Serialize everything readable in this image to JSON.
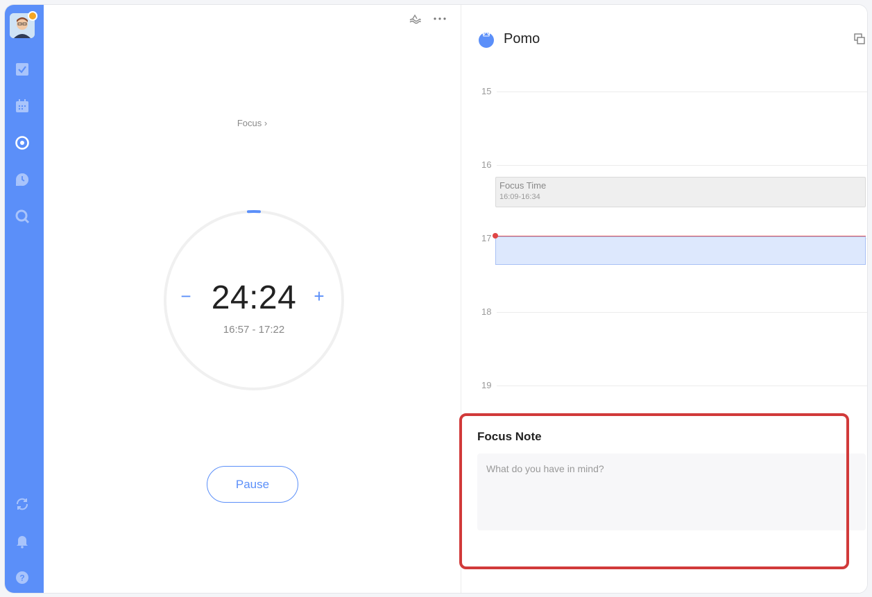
{
  "sidebar": {
    "items": [
      {
        "name": "tasks",
        "icon": "checkbox-icon"
      },
      {
        "name": "calendar",
        "icon": "calendar-icon"
      },
      {
        "name": "pomo",
        "icon": "target-icon"
      },
      {
        "name": "habit",
        "icon": "clock-pin-icon"
      },
      {
        "name": "search",
        "icon": "search-icon"
      },
      {
        "name": "sync",
        "icon": "sync-icon"
      },
      {
        "name": "notifications",
        "icon": "bell-icon"
      },
      {
        "name": "help",
        "icon": "help-icon"
      }
    ],
    "accent_color": "#5b8ff9"
  },
  "timer": {
    "mode_label": "Focus ›",
    "time": "24:24",
    "range": "16:57 - 17:22",
    "minus": "−",
    "plus": "+",
    "pause_label": "Pause",
    "progress_fraction": 0.02
  },
  "pomo": {
    "title": "Pomo",
    "hours": [
      "15",
      "16",
      "17",
      "18",
      "19"
    ],
    "event": {
      "title": "Focus Time",
      "time": "16:09-16:34"
    },
    "note": {
      "title": "Focus Note",
      "placeholder": "What do you have in mind?"
    }
  },
  "colors": {
    "highlight": "#d13a3a",
    "now_line": "#e04545",
    "current_block": "#dde8fd"
  }
}
